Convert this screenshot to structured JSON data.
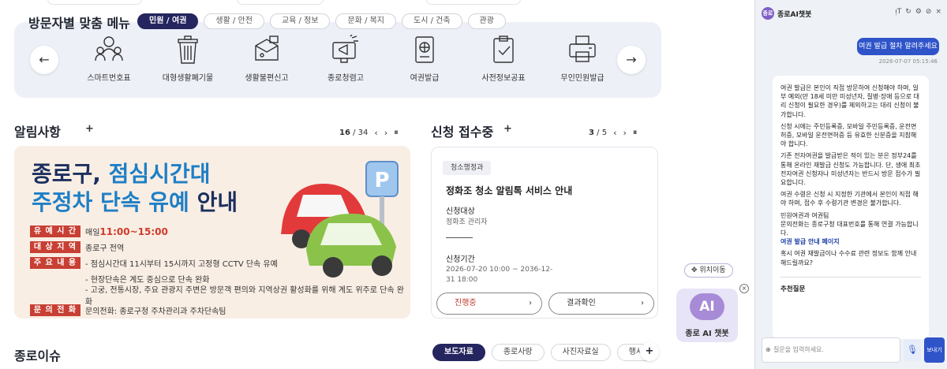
{
  "visitor_menu": {
    "title": "방문자별 맞춤 메뉴",
    "tabs": [
      "민원 / 여권",
      "생활 / 안전",
      "교육 / 정보",
      "문화 / 복지",
      "도시 / 건축",
      "관광"
    ],
    "prev_icon": "←",
    "next_icon": "→",
    "items": [
      {
        "label": "스마트번호표",
        "icon": "people-icon"
      },
      {
        "label": "대형생활폐기물",
        "icon": "trash-bin-icon"
      },
      {
        "label": "생활불편신고",
        "icon": "report-box-icon"
      },
      {
        "label": "종로청렴고",
        "icon": "megaphone-screen-icon"
      },
      {
        "label": "여권발급",
        "icon": "passport-icon"
      },
      {
        "label": "사전정보공표",
        "icon": "clipboard-check-icon"
      },
      {
        "label": "무인민원발급",
        "icon": "printer-icon"
      }
    ]
  },
  "notices": {
    "title": "알림사항",
    "add": "+",
    "pager_current": "16",
    "pager_total": "/ 34",
    "banner": {
      "line1a": "종로구, ",
      "line1b": "점심시간대",
      "line2a": "주정차 단속 유예",
      "line2b": " 안내",
      "rows": [
        {
          "tag": "유 예 시 간",
          "pre": "매일 ",
          "red": "11:00~15:00"
        },
        {
          "tag": "대 상 지 역",
          "text": "종로구 전역"
        },
        {
          "tag": "주 요 내 용",
          "text": "- 점심시간대 11시부터 15시까지 고정형 CCTV 단속 유예"
        },
        {
          "tag": "",
          "text": "- 현장단속은 계도 중심으로 단속 완화"
        },
        {
          "tag": "",
          "text": "- 고궁, 전통시장, 주요 관광지 주변은 방문객 편의와 지역상권 활성화를 위해 계도 위주로 단속 완화"
        },
        {
          "tag": "문 의 전 화",
          "text": "문의전화: 종로구청 주차관리과 주차단속팀"
        }
      ]
    }
  },
  "applications": {
    "title": "신청 접수중",
    "add": "+",
    "pager_current": "3",
    "pager_total": "/ 5",
    "card": {
      "badge": "청소행정과",
      "title": "정화조 청소 알림톡 서비스 안내",
      "target_label": "신청대상",
      "target_value": "정화조 관리자",
      "period_label": "신청기간",
      "period_value_1": "2026-07-20 10:00 ~ 2036-12-",
      "period_value_2": "31 18:00",
      "status_button": "진행중",
      "result_button": "결과확인"
    }
  },
  "widget": {
    "move_label": "위치이동",
    "ai_text": "AI",
    "label": "종로 AI 챗봇",
    "close": "×"
  },
  "bottom": {
    "title": "종로이슈",
    "tabs": [
      "보도자료",
      "종로사랑",
      "사진자료실",
      "행사"
    ],
    "add": "+"
  },
  "chatbot": {
    "logo": "종로",
    "title": "종로AI챗봇",
    "controls": [
      "ᴉT",
      "↻",
      "⚙",
      "⊘",
      "×"
    ],
    "user_message": "여권 발급 절차 알려주세요",
    "time": "2026-07-07 05:15:46",
    "answer": [
      "여권 발급은 본인이 직접 방문하여 신청해야 하며, 일부 예외(만 18세 미만 미성년자, 질병·장애 등으로 대리 신청이 필요한 경우)를 제외하고는 대리 신청이 불가합니다.",
      "신청 시에는 주민등록증, 모바일 주민등록증, 운전면허증, 모바일 운전면허증 등 유효한 신분증을 지참해야 합니다.",
      "기존 전자여권을 발급받은 적이 있는 분은 정부24를 통해 온라인 재발급 신청도 가능합니다. 단, 생애 최초 전자여권 신청자나 미성년자는 반드시 방문 접수가 필요합니다.",
      "여권 수령은 신청 시 지정한 기관에서 본인이 직접 해야 하며, 접수 후 수령기관 변경은 불가합니다.",
      "민원여권과 여권팀",
      "문의전화는 종로구청 대표번호를 통해 연결 가능합니다."
    ],
    "link": "여권 발급 안내 페이지",
    "followup": "혹시 여권 재발급이나 수수료 관련 정보도 함께 안내해드릴까요?",
    "recommend_title": "추천질문",
    "input_placeholder": "질문을 입력하세요.",
    "globe_icon": "⊕",
    "mic_icon": "🎙",
    "send_label": "보내기"
  }
}
